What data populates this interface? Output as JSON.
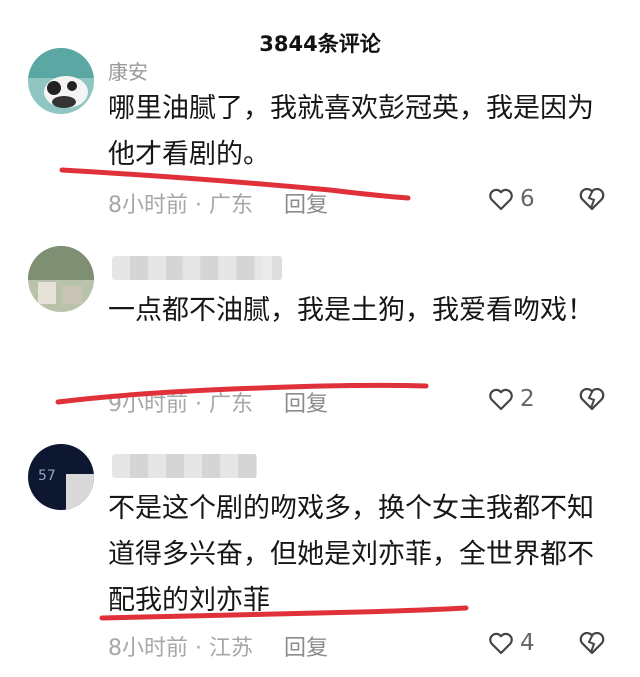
{
  "header": {
    "title": "3844条评论"
  },
  "comments": [
    {
      "user": "康安",
      "text": "哪里油腻了，我就喜欢彭冠英，我是因为他才看剧的。",
      "time": "8小时前",
      "location": "广东",
      "reply": "回复",
      "likes": "6"
    },
    {
      "user": "",
      "text": "一点都不油腻，我是土狗，我爱看吻戏！",
      "time": "9小时前",
      "location": "广东",
      "reply": "回复",
      "likes": "2"
    },
    {
      "user": "",
      "text": "不是这个剧的吻戏多，换个女主我都不知道得多兴奋，但她是刘亦菲，全世界都不配我的刘亦菲",
      "time": "8小时前",
      "location": "江苏",
      "reply": "回复",
      "likes": "4"
    }
  ],
  "colors": {
    "underline": "#e0303a",
    "meta": "#a7a7a7"
  },
  "icons": {
    "like": "heart-outline-icon",
    "dislike": "broken-heart-icon"
  }
}
